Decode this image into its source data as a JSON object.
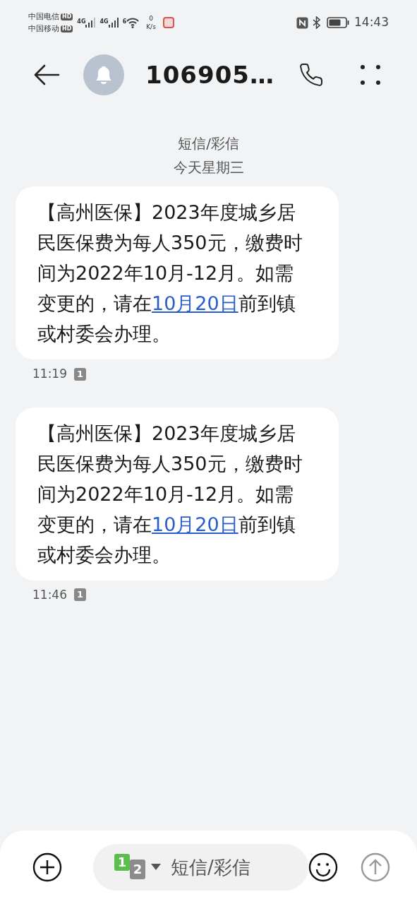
{
  "status_bar": {
    "carriers": [
      {
        "name": "中国电信",
        "badge": "HD"
      },
      {
        "name": "中国移动",
        "badge": "HD"
      }
    ],
    "signals": [
      {
        "label": "4G"
      },
      {
        "label": "4G"
      }
    ],
    "wifi_label": "6",
    "speed_value": "0",
    "speed_unit": "K/s",
    "time": "14:43"
  },
  "header": {
    "title": "106905…"
  },
  "thread": {
    "channel": "短信/彩信",
    "day": "今天星期三"
  },
  "messages": [
    {
      "before": "【高州医保】2023年度城乡居民医保费为每人350元，缴费时间为2022年10月-12月。如需变更的，请在",
      "link": "10月20日",
      "after": "前到镇或村委会办理。",
      "time": "11:19",
      "sim": "1"
    },
    {
      "before": "【高州医保】2023年度城乡居民医保费为每人350元，缴费时间为2022年10月-12月。如需变更的，请在",
      "link": "10月20日",
      "after": "前到镇或村委会办理。",
      "time": "11:46",
      "sim": "1"
    }
  ],
  "composer": {
    "sim_primary": "1",
    "sim_secondary": "2",
    "placeholder": "短信/彩信"
  }
}
